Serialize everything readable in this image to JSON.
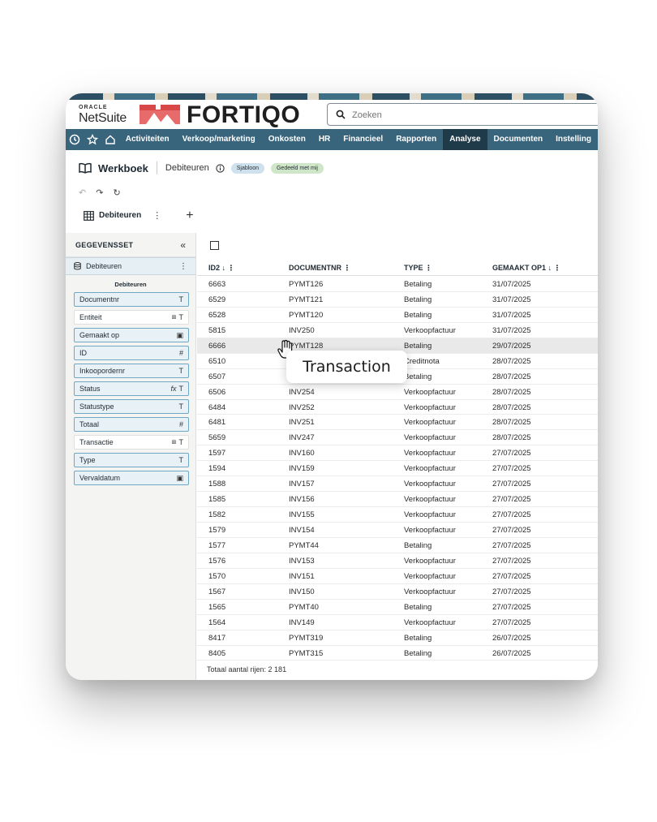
{
  "header": {
    "oracle_label": "ORACLE",
    "netsuite_label": "NetSuite",
    "brand": "FORTIQO",
    "search_placeholder": "Zoeken"
  },
  "nav": {
    "items": [
      "Activiteiten",
      "Verkoop/marketing",
      "Onkosten",
      "HR",
      "Financieel",
      "Rapporten",
      "Analyse",
      "Documenten",
      "Instelling"
    ],
    "active": "Analyse"
  },
  "workbook": {
    "title": "Werkboek",
    "name": "Debiteuren",
    "badge_template": "Sjabloon",
    "badge_shared": "Gedeeld met mij",
    "tab_label": "Debiteuren"
  },
  "sidebar": {
    "heading": "GEGEVENSSET",
    "dataset": "Debiteuren",
    "caption": "Debiteuren",
    "fields": [
      {
        "name": "Documentnr",
        "icon": "T"
      },
      {
        "name": "Entiteit",
        "icon": "T"
      },
      {
        "name": "Gemaakt op",
        "icon": "calendar"
      },
      {
        "name": "ID",
        "icon": "#"
      },
      {
        "name": "Inkoopordernr",
        "icon": "T"
      },
      {
        "name": "Status",
        "icon": "T"
      },
      {
        "name": "Statustype",
        "icon": "T"
      },
      {
        "name": "Totaal",
        "icon": "#"
      },
      {
        "name": "Transactie",
        "icon": "T"
      },
      {
        "name": "Type",
        "icon": "T"
      },
      {
        "name": "Vervaldatum",
        "icon": "calendar"
      }
    ]
  },
  "table": {
    "columns": [
      "ID2 ↓",
      "DOCUMENTNR",
      "TYPE",
      "GEMAAKT OP1 ↓"
    ],
    "rows": [
      [
        "6663",
        "PYMT126",
        "Betaling",
        "31/07/2025"
      ],
      [
        "6529",
        "PYMT121",
        "Betaling",
        "31/07/2025"
      ],
      [
        "6528",
        "PYMT120",
        "Betaling",
        "31/07/2025"
      ],
      [
        "5815",
        "INV250",
        "Verkoopfactuur",
        "31/07/2025"
      ],
      [
        "6666",
        "PYMT128",
        "Betaling",
        "29/07/2025"
      ],
      [
        "6510",
        "",
        "Creditnota",
        "28/07/2025"
      ],
      [
        "6507",
        "",
        "Betaling",
        "28/07/2025"
      ],
      [
        "6506",
        "INV254",
        "Verkoopfactuur",
        "28/07/2025"
      ],
      [
        "6484",
        "INV252",
        "Verkoopfactuur",
        "28/07/2025"
      ],
      [
        "6481",
        "INV251",
        "Verkoopfactuur",
        "28/07/2025"
      ],
      [
        "5659",
        "INV247",
        "Verkoopfactuur",
        "28/07/2025"
      ],
      [
        "1597",
        "INV160",
        "Verkoopfactuur",
        "27/07/2025"
      ],
      [
        "1594",
        "INV159",
        "Verkoopfactuur",
        "27/07/2025"
      ],
      [
        "1588",
        "INV157",
        "Verkoopfactuur",
        "27/07/2025"
      ],
      [
        "1585",
        "INV156",
        "Verkoopfactuur",
        "27/07/2025"
      ],
      [
        "1582",
        "INV155",
        "Verkoopfactuur",
        "27/07/2025"
      ],
      [
        "1579",
        "INV154",
        "Verkoopfactuur",
        "27/07/2025"
      ],
      [
        "1577",
        "PYMT44",
        "Betaling",
        "27/07/2025"
      ],
      [
        "1576",
        "INV153",
        "Verkoopfactuur",
        "27/07/2025"
      ],
      [
        "1570",
        "INV151",
        "Verkoopfactuur",
        "27/07/2025"
      ],
      [
        "1567",
        "INV150",
        "Verkoopfactuur",
        "27/07/2025"
      ],
      [
        "1565",
        "PYMT40",
        "Betaling",
        "27/07/2025"
      ],
      [
        "1564",
        "INV149",
        "Verkoopfactuur",
        "27/07/2025"
      ],
      [
        "8417",
        "PYMT319",
        "Betaling",
        "26/07/2025"
      ],
      [
        "8405",
        "PYMT315",
        "Betaling",
        "26/07/2025"
      ]
    ],
    "hover_row": 4,
    "footer": "Totaal aantal rijen: 2 181"
  },
  "tooltip": "Transaction",
  "colors": {
    "nav_bg": "#38657c",
    "nav_active": "#1f3a49",
    "brand_red": "#e05a5a",
    "field_border": "#6fa8c3"
  }
}
